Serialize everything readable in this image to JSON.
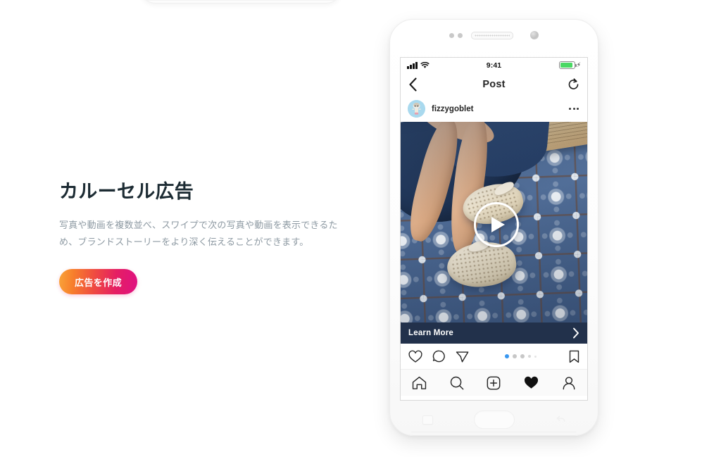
{
  "page": {
    "background_color": "#ffffff"
  },
  "promo": {
    "title": "カルーセル広告",
    "body": "写真や動画を複数並べ、スワイプで次の写真や動画を表示できるため、ブランドストーリーをより深く伝えることができます。",
    "cta_label": "広告を作成",
    "cta_gradient_from": "#f9a43a",
    "cta_gradient_to": "#df1182",
    "title_color": "#1c2b33",
    "body_color": "#8e9aa3"
  },
  "phone": {
    "status_bar": {
      "time": "9:41",
      "signal_icon": "cellular-signal-icon",
      "wifi_icon": "wifi-icon",
      "battery_icon": "battery-icon",
      "battery_color": "#4ad863",
      "charging_icon": "lightning-bolt-icon"
    },
    "nav_bar": {
      "back_icon": "chevron-left-icon",
      "title": "Post",
      "refresh_icon": "refresh-icon"
    },
    "post": {
      "avatar_icon": "avatar",
      "avatar_color": "#a9d9ee",
      "username": "fizzygoblet",
      "more_icon": "more-options-icon",
      "media": {
        "play_icon": "play-button-icon",
        "description": "Feet wearing cream crochet shoes on blue and white patterned tile floor"
      },
      "cta": {
        "label": "Learn More",
        "chevron_icon": "chevron-right-icon",
        "background_color": "#22314b"
      },
      "actions": {
        "like_icon": "heart-outline-icon",
        "comment_icon": "comment-bubble-icon",
        "share_icon": "send-paper-plane-icon",
        "save_icon": "bookmark-outline-icon"
      },
      "carousel": {
        "total": 5,
        "active_index": 0,
        "active_color": "#3897f0"
      }
    },
    "tab_bar": {
      "items": [
        {
          "name": "home",
          "icon": "home-icon",
          "active": false
        },
        {
          "name": "search",
          "icon": "search-icon",
          "active": false
        },
        {
          "name": "add",
          "icon": "add-plus-square-icon",
          "active": false
        },
        {
          "name": "activity",
          "icon": "heart-filled-icon",
          "active": true
        },
        {
          "name": "profile",
          "icon": "person-outline-icon",
          "active": false
        }
      ]
    },
    "hardware": {
      "earpiece_icon": "earpiece-speaker-icon",
      "camera_icon": "front-camera-icon",
      "recents_icon": "recents-square-icon",
      "home_icon": "home-pill-button-icon",
      "back_icon": "back-arrow-icon"
    }
  }
}
